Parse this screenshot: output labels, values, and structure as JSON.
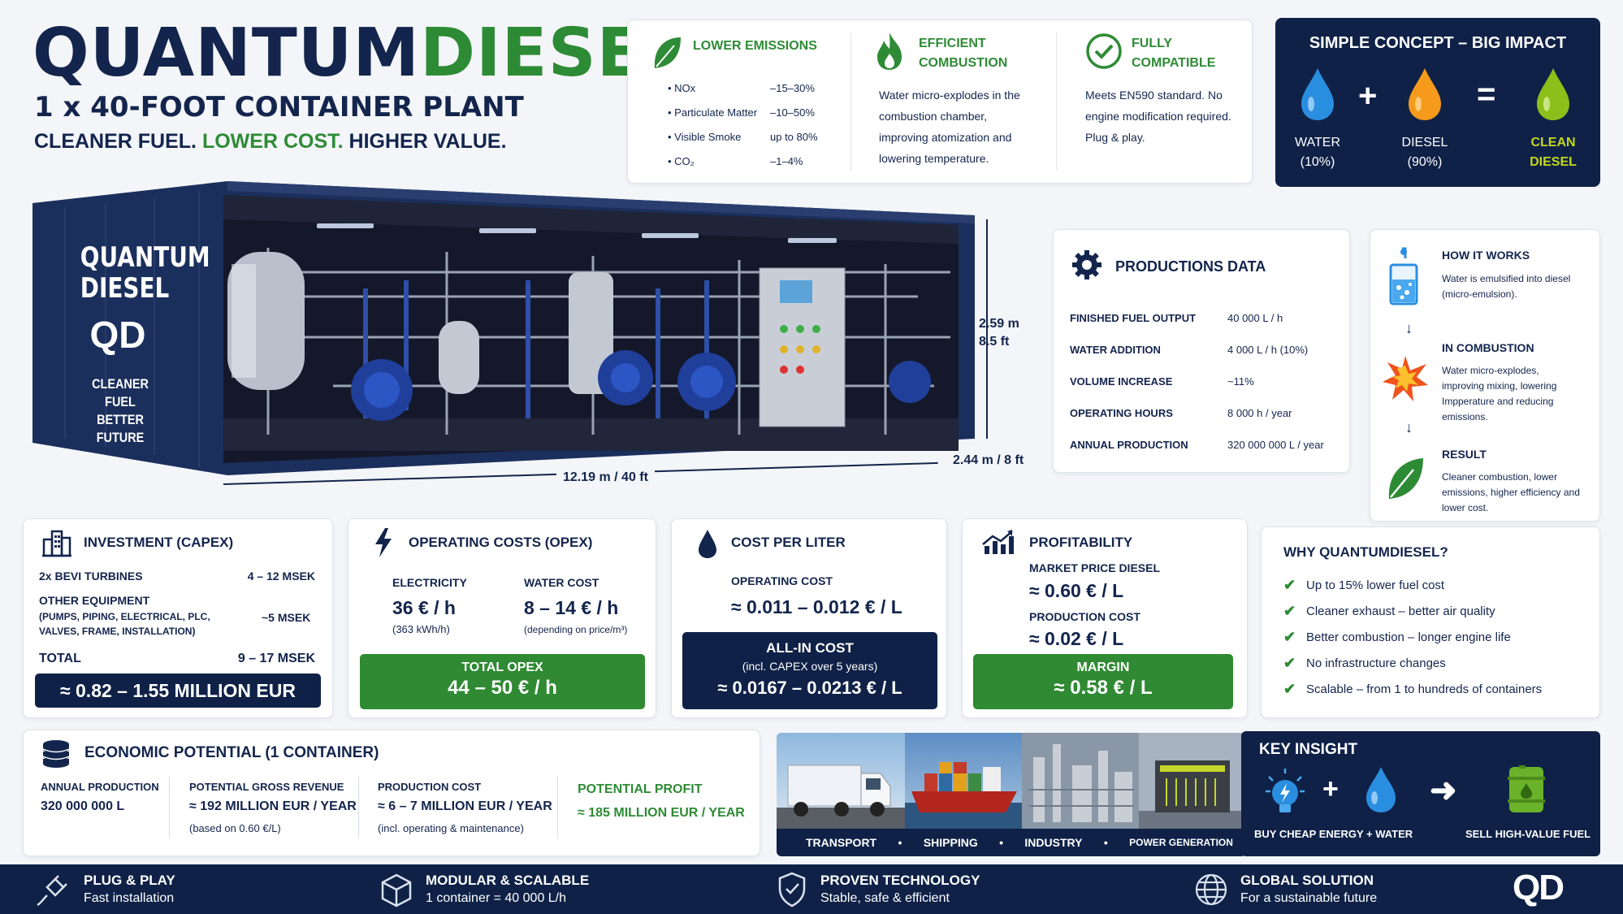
{
  "brand": {
    "name_a": "QUANTUM",
    "name_b": "DIESEL",
    "subtitle": "1 x 40-FOOT CONTAINER PLANT",
    "tag_a": "CLEANER FUEL.",
    "tag_b": "LOWER COST.",
    "tag_c": "HIGHER VALUE."
  },
  "container": {
    "brand_line1": "QUANTUM",
    "brand_line2": "DIESEL",
    "logo": "QD",
    "tag_line1": "CLEANER FUEL",
    "tag_line2": "BETTER FUTURE",
    "height_m": "2.59 m",
    "height_ft": "8.5 ft",
    "length": "12.19 m / 40 ft",
    "width": "2.44 m / 8 ft"
  },
  "emissions": {
    "title": "LOWER EMISSIONS",
    "items": [
      {
        "name": "NOx",
        "value": "–15–30%"
      },
      {
        "name": "Particulate Matter",
        "value": "–10–50%"
      },
      {
        "name": "Visible Smoke",
        "value": "up to 80%"
      },
      {
        "name": "CO₂",
        "value": "–1–4%"
      }
    ]
  },
  "combustion": {
    "title_1": "EFFICIENT",
    "title_2": "COMBUSTION",
    "text": "Water micro-explodes in the combustion chamber, improving atomization and lowering temperature."
  },
  "compatible": {
    "title_1": "FULLY",
    "title_2": "COMPATIBLE",
    "text_1": "Meets EN590 standard. No engine modification required.",
    "text_2": "Plug & play."
  },
  "concept": {
    "title": "SIMPLE CONCEPT – BIG IMPACT",
    "water": "WATER",
    "water_pct": "(10%)",
    "diesel": "DIESEL",
    "diesel_pct": "(90%)",
    "clean_1": "CLEAN",
    "clean_2": "DIESEL",
    "plus": "+",
    "eq": "="
  },
  "production": {
    "title": "PRODUCTIONS DATA",
    "rows": [
      {
        "label": "FINISHED FUEL OUTPUT",
        "value": "40 000 L / h"
      },
      {
        "label": "WATER ADDITION",
        "value": "4 000 L / h (10%)"
      },
      {
        "label": "VOLUME INCREASE",
        "value": "~11%"
      },
      {
        "label": "OPERATING HOURS",
        "value": "8 000 h / year"
      },
      {
        "label": "ANNUAL PRODUCTION",
        "value": "320 000 000 L / year"
      }
    ]
  },
  "how": {
    "s1_title": "HOW IT WORKS",
    "s1_text": "Water is emulsified into diesel (micro-emulsion).",
    "s2_title": "IN COMBUSTION",
    "s2_text": "Water micro-explodes, improving mixing, lowering Impperature and reducing emissions.",
    "s3_title": "RESULT",
    "s3_text": "Cleaner combustion, lower emissions, higher efficiency and lower cost."
  },
  "capex": {
    "title": "INVESTMENT (CAPEX)",
    "r1_label": "2x BEVI TURBINES",
    "r1_value": "4 – 12 MSEK",
    "r2_label": "OTHER EQUIPMENT",
    "r2_sub": "(PUMPS, PIPING, ELECTRICAL, PLC, VALVES, FRAME, INSTALLATION)",
    "r2_value": "~5 MSEK",
    "total_label": "TOTAL",
    "total_value": "9 – 17 MSEK",
    "eur": "≈ 0.82 – 1.55 MILLION EUR"
  },
  "opex": {
    "title": "OPERATING COSTS (OPEX)",
    "e_label": "ELECTRICITY",
    "e_value": "36 € / h",
    "e_sub": "(363 kWh/h)",
    "w_label": "WATER COST",
    "w_value": "8 – 14 € / h",
    "w_sub": "(depending on price/m³)",
    "total_label": "TOTAL OPEX",
    "total_value": "44 – 50 € / h"
  },
  "cpl": {
    "title": "COST PER LITER",
    "op_label": "OPERATING COST",
    "op_value": "≈ 0.011 – 0.012 € / L",
    "all_label": "ALL-IN COST",
    "all_sub": "(incl. CAPEX over 5 years)",
    "all_value": "≈ 0.0167 – 0.0213 € / L"
  },
  "profit": {
    "title": "PROFITABILITY",
    "mp_label": "MARKET PRICE DIESEL",
    "mp_value": "≈ 0.60 € / L",
    "pc_label": "PRODUCTION COST",
    "pc_value": "≈ 0.02 € / L",
    "margin_label": "MARGIN",
    "margin_value": "≈ 0.58 € / L"
  },
  "why": {
    "title": "WHY QUANTUMDIESEL?",
    "items": [
      "Up to 15% lower fuel cost",
      "Cleaner exhaust – better air quality",
      "Better combustion – longer engine life",
      "No infrastructure changes",
      "Scalable – from 1 to hundreds of containers"
    ]
  },
  "econ": {
    "title": "ECONOMIC POTENTIAL (1 CONTAINER)",
    "c1_label": "ANNUAL PRODUCTION",
    "c1_value": "320 000 000 L",
    "c2_label": "POTENTIAL GROSS REVENUE",
    "c2_value": "≈ 192 MILLION EUR / YEAR",
    "c2_sub": "(based on 0.60 €/L)",
    "c3_label": "PRODUCTION COST",
    "c3_value": "≈ 6 – 7 MILLION EUR / YEAR",
    "c3_sub": "(incl. operating & maintenance)",
    "c4_label": "POTENTIAL PROFIT",
    "c4_value": "≈ 185 MILLION EUR / YEAR"
  },
  "apps": {
    "items": [
      "TRANSPORT",
      "SHIPPING",
      "INDUSTRY",
      "POWER GENERATION"
    ]
  },
  "insight": {
    "title": "KEY INSIGHT",
    "left": "BUY CHEAP ENERGY + WATER",
    "right": "SELL HIGH-VALUE FUEL",
    "plus": "+"
  },
  "footer": {
    "f1_title": "PLUG & PLAY",
    "f1_sub": "Fast installation",
    "f2_title": "MODULAR & SCALABLE",
    "f2_sub": "1 container = 40 000 L/h",
    "f3_title": "PROVEN TECHNOLOGY",
    "f3_sub": "Stable, safe & efficient",
    "f4_title": "GLOBAL SOLUTION",
    "f4_sub": "For a sustainable future",
    "logo": "QD"
  },
  "colors": {
    "navy": "#0f2147",
    "green": "#2e8b35",
    "water_blue": "#2a8ee0",
    "diesel_orange": "#f59a1b",
    "clean_green": "#8bbf1a"
  }
}
